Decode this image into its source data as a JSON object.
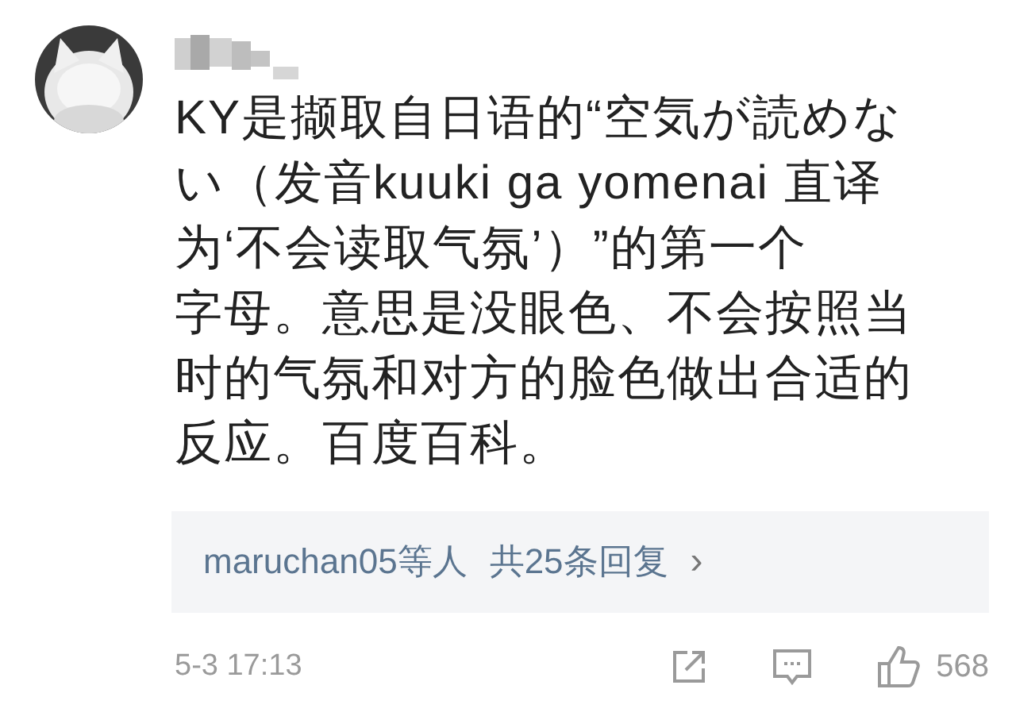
{
  "comment": {
    "lines": [
      "KY是撷取自日语的“空気が読めな",
      "い（发音kuuki ga yomenai 直译",
      "为‘不会读取气氛’）”的第一个",
      "字母。意思是没眼色、不会按照当",
      "时的气氛和对方的脸色做出合适的",
      "反应。百度百科。"
    ],
    "replies": {
      "text": "maruchan05等人",
      "count": "共25条回复",
      "arrow": "›"
    },
    "time": "5-3 17:13",
    "likes": "568"
  }
}
